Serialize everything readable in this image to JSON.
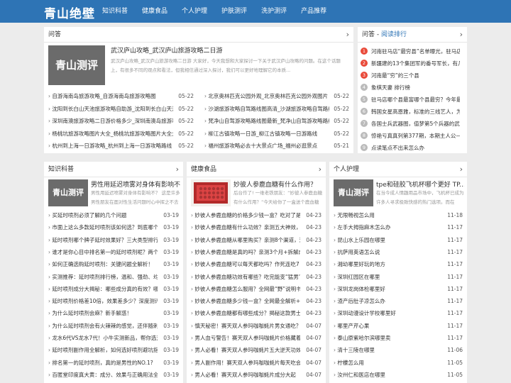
{
  "site": {
    "logo": "青山绝壁"
  },
  "nav": [
    "知识科普",
    "健康食品",
    "个人护理",
    "护肤测评",
    "洗护测评",
    "产品推荐"
  ],
  "qa": {
    "title": "问答",
    "feature": {
      "thumb_text": "青山测评",
      "title": "武汉庐山攻略_武汉庐山旅游攻略二日游",
      "desc": "武汉庐山攻略_武汉庐山旅游攻略二日游 大家好，今天我想和大家探讨一下关于武汉庐山攻略的问题。在这个话题上，有很多不同的观点和看法，但我相信通过深入探讨，我们可以更好地理解它的本质..."
    },
    "left": [
      {
        "t": "杭州到上海一日游攻略_杭州到上海一日游攻略路线",
        "d": "05-22"
      },
      {
        "t": "杨桃坑旅游攻略图片大全_杨桃坑旅游攻略图片大全大图",
        "d": "05-22"
      },
      {
        "t": "深圳南澳旅游攻略二日游价格多少_深圳南澳岛旅游攻",
        "d": "05-22"
      },
      {
        "t": "沈阳到长白山天池旅游攻略自助游_沈阳到长白山天池",
        "d": "05-22"
      },
      {
        "t": "自游海南岛旅游攻略_自游海南岛旅游攻略图",
        "d": "05-22"
      }
    ],
    "right": [
      {
        "t": "福州旅游攻略必去十大景点广场_福州必逛景点",
        "d": "05-21"
      },
      {
        "t": "柳江古镇攻略一日游_柳江古镇攻略一日游路线",
        "d": "05-22"
      },
      {
        "t": "梵净山自驾游攻略路线图最新_梵净山自驾游攻略路线图",
        "d": "05-22"
      },
      {
        "t": "沙湖旅游攻略自驾路线图高清_沙湖旅游攻略自驾路线",
        "d": "05-22"
      },
      {
        "t": "北京奥林匹克公园外观_北京奥林匹克公园外观图片",
        "d": "05-22"
      }
    ]
  },
  "rank": {
    "title_prefix": "问答 - ",
    "title_accent": "阅读排行",
    "items": [
      "河南驻马店“最穷县”名单曝光，驻马店...",
      "新疆建的13个集团军的番号军长，有几...",
      "河南最“穷”的三个县",
      "象棋天妻 排行榜",
      "驻马店哪个县最富哪个县最穷？今年最...",
      "韩国女星高恩雅，标准的三线艺人，为...",
      "各国士兵武器图，值梦第5个兵器的武...",
      "惊艳亏真真列第377期，本期主人公——...",
      "点读笔点不出来怎么办"
    ]
  },
  "col1": {
    "title": "知识科普",
    "thumb_text": "青山测评",
    "feat_title": "男性用延迟喷雾对身体有影响不",
    "feat_desc": "男性用延迟喷雾对身体有影响不？ 这是许多男性朋友在面对性生活问题时心中挥之不去的疑惑。",
    "items": [
      {
        "t": "买延时喷剂必须了解的几个问题",
        "d": "03-19"
      },
      {
        "t": "市面上这么多款延时喷剂该如何选？到底哪个喷剂",
        "d": "03-19"
      },
      {
        "t": "延时喷剂哪个牌子延时效果好？三大类型排行榜",
        "d": "03-19"
      },
      {
        "t": "谁才是你心目中排名第一的延时喷剂呢？两个极",
        "d": "03-19"
      },
      {
        "t": "如何正确选购延时喷剂：关键问题全解析！",
        "d": "03-19"
      },
      {
        "t": "实测推荐：延时喷剂排行榜，温和、强劲、均衡全",
        "d": "03-19"
      },
      {
        "t": "延时喷剂成分大揭秘：哪些成分真的有效？哪些是",
        "d": "03-19"
      },
      {
        "t": "延时喷剂价格差10倍，效果差多少？深度测评告",
        "d": "03-19"
      },
      {
        "t": "为什么延时喷剂会麻？新手解惑！",
        "d": "03-19"
      },
      {
        "t": "为什么延时喷剂会有火辣辣的感觉，还伴随刺痛？",
        "d": "03-19"
      },
      {
        "t": "龙水6代VS龙水7代！小牛实测新品，帮你选对延",
        "d": "03-19"
      },
      {
        "t": "延时喷剂副作用全解析，如何选好喷剂避坑指南",
        "d": "03-19"
      },
      {
        "t": "排名第一的延时喷剂，真的是男性的NO.1?",
        "d": "03-19"
      },
      {
        "t": "百匿堂印度真大黄：成分、效果与正确用法全解析",
        "d": "03-19"
      }
    ]
  },
  "col2": {
    "title": "健康食品",
    "feat_title": "妙彼人参鹿血糖有什么作用？",
    "feat_desc": "后台作了! 一维老铁朋友：“妙彼人参鹿血糖有什么作用？”今天给你了一盒送个鹿血糖尝尝看，",
    "items": [
      {
        "t": "妙彼人参鹿血糖的价格多少钱一盒？吃对了是宝，",
        "d": "04-23"
      },
      {
        "t": "妙彼人参鹿血糖有什么功效？亲测五大神效，老司",
        "d": "04-23"
      },
      {
        "t": "妙彼人参鹿血糖从哪里购买？亲测8个渠道，这3",
        "d": "04-23"
      },
      {
        "t": "妙彼人参鹿血糖是真的吗？亲测3个月+拆解成",
        "d": "04-23"
      },
      {
        "t": "妙彼人参鹿血糖可以每天都吃吗？作死连吃7",
        "d": "04-23"
      },
      {
        "t": "妙彼人参鹿血糖功效有哪些？吃完能变“猛男”？亲",
        "d": "04-23"
      },
      {
        "t": "妙彼人参鹿血糖怎么服用？全网最“野”说明书来",
        "d": "04-23"
      },
      {
        "t": "妙彼人参鹿血糖多少钱一盒？全网最全解析+真实",
        "d": "04-23"
      },
      {
        "t": "妙彼人参鹿血糖都有哪些成分？揭秘这款男士保健",
        "d": "04-23"
      },
      {
        "t": "慎天秘密！赛天双人参玛咖咖蚝片男女通吃？猛男",
        "d": "04-07"
      },
      {
        "t": "男人血亏警告！赛天双人参玛咖蚝片价格藏着怏",
        "d": "04-07"
      },
      {
        "t": "男人必看！赛天双人参玛咖蚝片五大逆天功效曝",
        "d": "04-07"
      },
      {
        "t": "男人副作用！赛天双人参玛咖咖蚝片每天吃会",
        "d": "04-07"
      },
      {
        "t": "男人必看！赛天双人参玛咖咖蚝片成分大起",
        "d": "04-07"
      }
    ]
  },
  "col3": {
    "title": "个人护理",
    "thumb_text": "青山测评",
    "feat_title": "tpe和硅胶飞机杯哪个更好 TP...",
    "feat_desc": "在当今成人情趣用品市场中，飞机杯已成为许多人寻求极致快感的热门选项。而在",
    "items": [
      {
        "t": "无限畅视怎么用",
        "d": "11-18"
      },
      {
        "t": "左手大拇指麻木怎么办",
        "d": "11-17"
      },
      {
        "t": "昆山水上乐园在哪里",
        "d": "11-17"
      },
      {
        "t": "抗萨用英语怎么说",
        "d": "11-17"
      },
      {
        "t": "湘幼哪里好玩的地方",
        "d": "11-17"
      },
      {
        "t": "深圳红园区在哪里",
        "d": "11-17"
      },
      {
        "t": "深圳龙岗体检哪里好",
        "d": "11-17"
      },
      {
        "t": "渣产后肚子凉怎么办",
        "d": "11-17"
      },
      {
        "t": "深圳动漫设计学校哪里好",
        "d": "11-17"
      },
      {
        "t": "哪里产芹心果",
        "d": "11-17"
      },
      {
        "t": "泰山原紫哈尔滨哪里卖",
        "d": "11-17"
      },
      {
        "t": "清十三陵在哪里",
        "d": "11-06"
      },
      {
        "t": "柠檬怎么用",
        "d": "11-05"
      },
      {
        "t": "汝州仁和医店在哪里",
        "d": "11-05"
      }
    ]
  }
}
